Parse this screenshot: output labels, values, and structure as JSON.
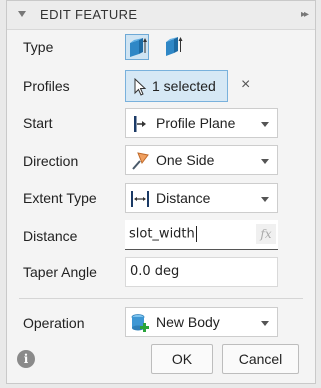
{
  "header": {
    "title": "EDIT FEATURE"
  },
  "rows": {
    "type": {
      "label": "Type"
    },
    "profiles": {
      "label": "Profiles",
      "value": "1 selected",
      "clear": "×"
    },
    "start": {
      "label": "Start",
      "value": "Profile Plane",
      "icon": "profile-plane-icon"
    },
    "direction": {
      "label": "Direction",
      "value": "One Side",
      "icon": "one-side-flag-icon"
    },
    "extent_type": {
      "label": "Extent Type",
      "value": "Distance",
      "icon": "distance-icon"
    },
    "distance": {
      "label": "Distance",
      "value": "slot_width",
      "fx": "fx"
    },
    "taper_angle": {
      "label": "Taper Angle",
      "value": "0.0 deg"
    },
    "operation": {
      "label": "Operation",
      "value": "New Body",
      "icon": "new-body-icon"
    }
  },
  "footer": {
    "ok": "OK",
    "cancel": "Cancel",
    "info": "i"
  },
  "colors": {
    "selection_bg": "#d6e8f5",
    "selection_border": "#79b1dc"
  }
}
